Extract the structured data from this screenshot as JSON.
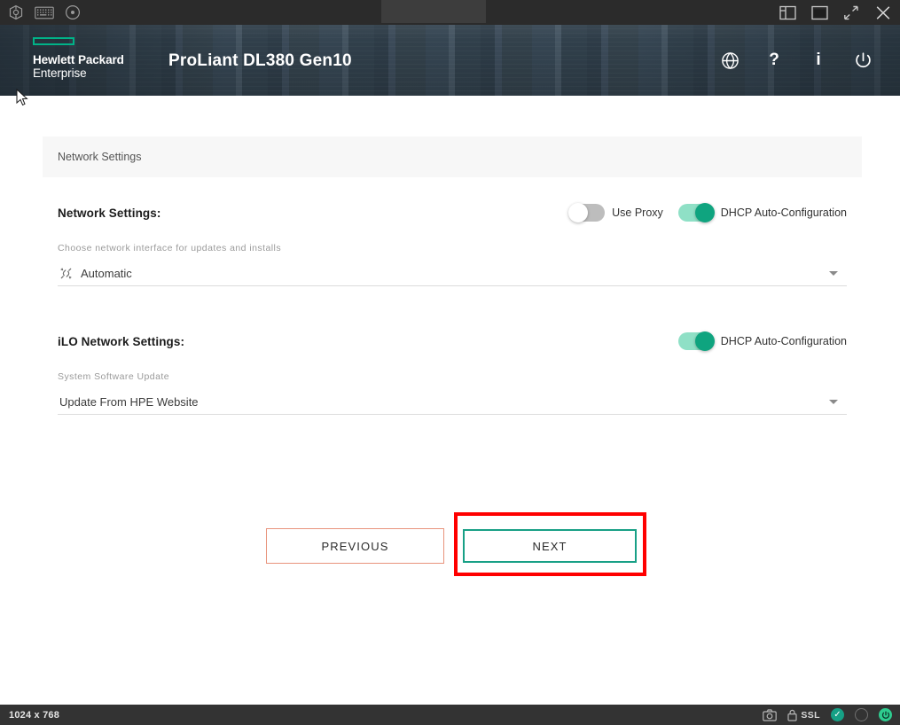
{
  "top_bar": {
    "icons": [
      {
        "name": "virtual-media-box-icon",
        "label": "Virtual Media"
      },
      {
        "name": "keyboard-icon",
        "label": "Keyboard"
      },
      {
        "name": "disc-icon",
        "label": "Virtual Disc"
      }
    ],
    "window_icons": [
      {
        "name": "layout-panel-icon",
        "label": "Layout"
      },
      {
        "name": "window-icon",
        "label": "Window"
      },
      {
        "name": "expand-icon",
        "label": "Fullscreen"
      },
      {
        "name": "close-icon",
        "label": "Close"
      }
    ]
  },
  "header": {
    "brand_line1": "Hewlett Packard",
    "brand_line2": "Enterprise",
    "product_title": "ProLiant DL380 Gen10",
    "accent_color": "#00b388",
    "actions": [
      {
        "name": "globe-icon",
        "glyph": "language"
      },
      {
        "name": "help-icon",
        "glyph": "?"
      },
      {
        "name": "info-icon",
        "glyph": "i"
      },
      {
        "name": "power-icon",
        "glyph": "power"
      }
    ]
  },
  "panel": {
    "header_title": "Network Settings"
  },
  "network_settings": {
    "title": "Network Settings:",
    "use_proxy": {
      "label": "Use Proxy",
      "state": "off"
    },
    "dhcp": {
      "label": "DHCP Auto-Configuration",
      "state": "on"
    },
    "interface_label": "Choose network interface for updates and installs",
    "interface_value": "Automatic",
    "interface_icon": "network-interface-icon"
  },
  "ilo_settings": {
    "title": "iLO Network Settings:",
    "dhcp": {
      "label": "DHCP Auto-Configuration",
      "state": "on"
    },
    "update_label": "System Software Update",
    "update_value": "Update From HPE Website"
  },
  "buttons": {
    "previous": "PREVIOUS",
    "next": "NEXT",
    "previous_border_color": "#e8937c",
    "next_border_color": "#18a086",
    "highlight_color": "#ff0000"
  },
  "status_bar": {
    "resolution": "1024 x 768",
    "ssl_label": "SSL",
    "icons": [
      {
        "name": "camera-icon"
      },
      {
        "name": "lock-icon"
      },
      {
        "name": "status-ok-icon"
      },
      {
        "name": "status-empty-icon"
      },
      {
        "name": "power-status-icon"
      }
    ]
  }
}
